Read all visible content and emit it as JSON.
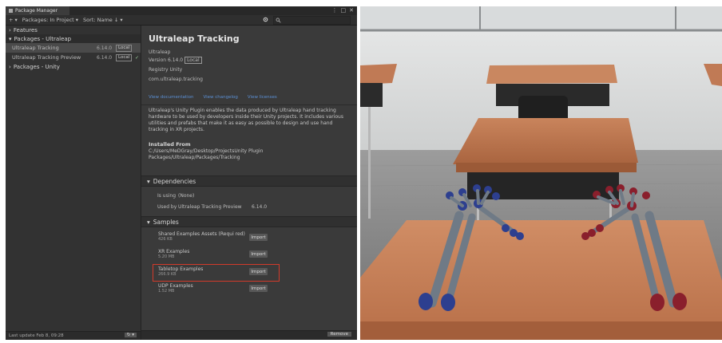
{
  "window": {
    "tab_title": "Package Manager",
    "controls": [
      "⋮",
      "□",
      "✕"
    ]
  },
  "toolbar": {
    "add_label": "+ ▾",
    "filter_label": "Packages: In Project ▾",
    "sort_label": "Sort: Name ↓ ▾",
    "settings_icon": "gear-icon"
  },
  "sidebar": {
    "features": "Features",
    "group_ultraleap": "Packages - Ultraleap",
    "packages": [
      {
        "name": "Ultraleap Tracking",
        "version": "6.14.0",
        "badge": "Local",
        "check": ""
      },
      {
        "name": "Ultraleap Tracking Preview",
        "version": "6.14.0",
        "badge": "Local",
        "check": "✓"
      }
    ],
    "group_unity": "Packages - Unity",
    "last_update": "Last update Feb 8, 09:28",
    "refresh_label": "↻ ▾"
  },
  "details": {
    "title": "Ultraleap Tracking",
    "author": "Ultraleap",
    "version_label": "Version 6.14.0",
    "version_badge": "Local",
    "registry": "Registry   Unity",
    "package_id": "com.ultraleap.tracking",
    "links": [
      "View documentation",
      "View changelog",
      "View licenses"
    ],
    "description": "Ultraleap's Unity Plugin enables the data produced by Ultraleap hand tracking hardware to be used by developers inside their Unity projects. It includes various utilities and prefabs that make it as easy as possible to design and use hand tracking in XR projects.",
    "installed_from_label": "Installed From",
    "installed_from_path": "C:/Users/MeDGray/Desktop/ProjectsUnity Plugin Packages/Ultraleap/Packages/Tracking",
    "dependencies_header": "Dependencies",
    "deps": [
      {
        "label": "Is using",
        "value": "(None)",
        "ver": ""
      },
      {
        "label": "Used by",
        "value": "Ultraleap Tracking Preview",
        "ver": "6.14.0"
      }
    ],
    "samples_header": "Samples",
    "samples": [
      {
        "name": "Shared Examples Assets (Requi red)",
        "size": "426 KB",
        "import": "Import"
      },
      {
        "name": "XR Examples",
        "size": "5.20 MB",
        "import": "Import"
      },
      {
        "name": "Tabletop Examples",
        "size": "266.9 KB",
        "import": "Import"
      },
      {
        "name": "UDP Examples",
        "size": "1.52 MB",
        "import": "Import"
      }
    ],
    "remove_label": "Remove"
  },
  "colors": {
    "highlight": "#d23a2a",
    "link": "#5b8fd3",
    "hand_left": "#2d3f8f",
    "hand_right": "#8a1f2c"
  }
}
